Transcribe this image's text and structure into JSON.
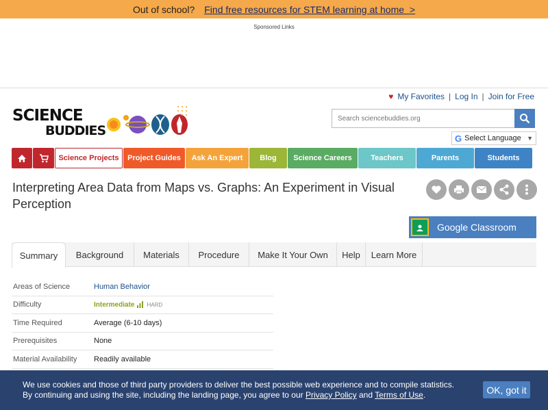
{
  "topbar": {
    "prefix": "Out of school?",
    "link": "Find free resources for STEM learning at home",
    "arrow": ">"
  },
  "sponsored": "Sponsored Links",
  "account": {
    "favorites": "My Favorites",
    "login": "Log In",
    "join": "Join for Free",
    "sep": "|"
  },
  "logo": {
    "line1": "SCIENCE",
    "line2": "BUDDIES"
  },
  "search": {
    "placeholder": "Search sciencebuddies.org"
  },
  "language": {
    "label": "Select Language"
  },
  "nav": {
    "science_projects": "Science Projects",
    "project_guides": "Project Guides",
    "ask_an_expert": "Ask An Expert",
    "blog": "Blog",
    "science_careers": "Science Careers",
    "teachers": "Teachers",
    "parents": "Parents",
    "students": "Students"
  },
  "page": {
    "title": "Interpreting Area Data from Maps vs. Graphs: An Experiment in Visual Perception",
    "google_classroom": "Google Classroom"
  },
  "tabs": [
    "Summary",
    "Background",
    "Materials",
    "Procedure",
    "Make It Your Own",
    "Help",
    "Learn More"
  ],
  "info": {
    "areas_label": "Areas of Science",
    "areas_value": "Human Behavior",
    "difficulty_label": "Difficulty",
    "difficulty_value": "Intermediate",
    "difficulty_scale": "HARD",
    "time_label": "Time Required",
    "time_value": "Average (6-10 days)",
    "prereq_label": "Prerequisites",
    "prereq_value": "None",
    "material_label": "Material Availability",
    "material_value": "Readily available"
  },
  "cookie": {
    "line1": "We use cookies and those of third party providers to deliver the best possible web experience and to compile statistics.",
    "line2_a": "By continuing and using the site, including the landing page, you agree to our",
    "privacy": "Privacy Policy",
    "and": "and",
    "terms": "Terms of Use",
    "period": ".",
    "ok": "OK, got it"
  },
  "colors": {
    "accent_red": "#c0272d",
    "accent_blue": "#4a7fc0",
    "banner_orange": "#f5a94a"
  }
}
